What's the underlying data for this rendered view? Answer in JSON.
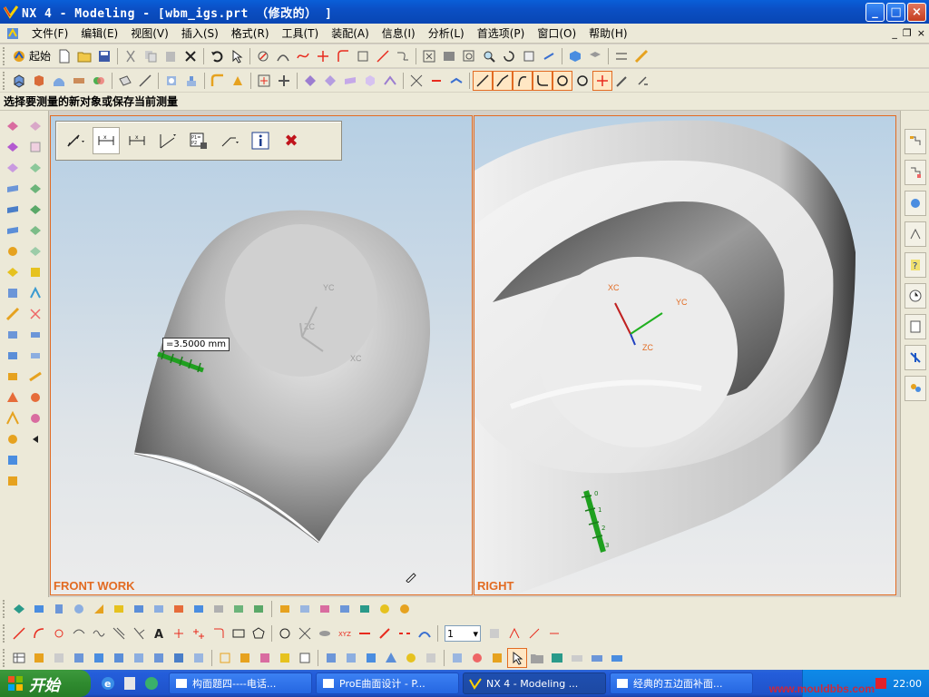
{
  "window": {
    "title": "NX 4 - Modeling - [wbm_igs.prt （修改的） ]",
    "buttons": [
      "_",
      "□",
      "×"
    ]
  },
  "menubar": {
    "items": [
      "文件(F)",
      "编辑(E)",
      "视图(V)",
      "插入(S)",
      "格式(R)",
      "工具(T)",
      "装配(A)",
      "信息(I)",
      "分析(L)",
      "首选项(P)",
      "窗口(O)",
      "帮助(H)"
    ],
    "mdi_buttons": [
      "_",
      "❐",
      "×"
    ]
  },
  "toolbar": {
    "start_label": "起始"
  },
  "status": {
    "prompt": "选择要测量的新对象或保存当前测量"
  },
  "viewports": {
    "left_label": "FRONT WORK",
    "right_label": "RIGHT",
    "dimension": "=3.5000 mm",
    "left_axes": [
      "YC",
      "ZC",
      "XC"
    ],
    "right_axes": [
      "XC",
      "YC",
      "ZC"
    ],
    "ruler_ticks": [
      "0",
      "1",
      "2",
      "3"
    ]
  },
  "measure_dialog": {
    "close_label": "✖"
  },
  "bottom": {
    "layer_value": "1"
  },
  "taskbar": {
    "start": "开始",
    "tasks": [
      "构面题四----电话...",
      "ProE曲面设计 - P...",
      "NX 4 - Modeling ...",
      "经典的五边面补面..."
    ],
    "clock": "22:00"
  },
  "watermark": "www.mouldbbs.com",
  "colors": {
    "title_blue": "#0b4fc4",
    "viewport_border": "#e26b22",
    "measure_green": "#1fa01f",
    "taskbar_blue": "#245edb",
    "start_green": "#2f8a2f"
  }
}
